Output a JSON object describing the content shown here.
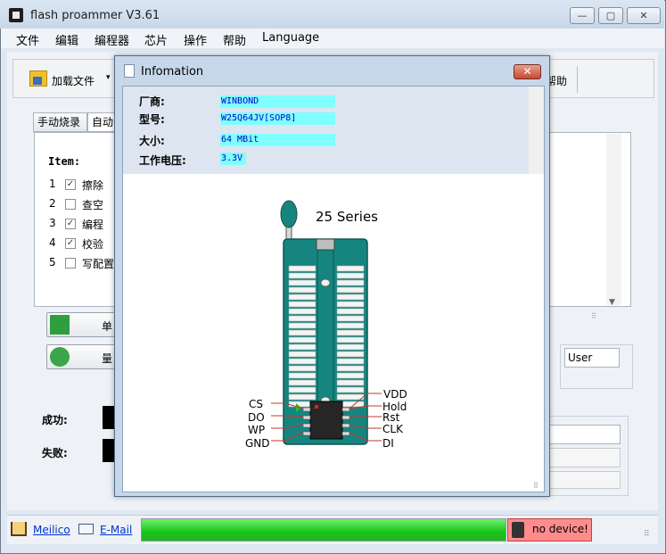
{
  "window": {
    "title": "flash proammer V3.61",
    "min": "—",
    "max": "▢",
    "close": "✕"
  },
  "menu": [
    "文件",
    "编辑",
    "编程器",
    "芯片",
    "操作",
    "帮助",
    "Language"
  ],
  "toolbar": {
    "load_label": "加载文件",
    "load_arrow": "▾",
    "help_label": "帮助"
  },
  "tabs": [
    "手动烧录",
    "自动"
  ],
  "items": {
    "header": "Item:",
    "list": [
      {
        "num": "1",
        "label": "擦除",
        "checked": true
      },
      {
        "num": "2",
        "label": "查空",
        "checked": false
      },
      {
        "num": "3",
        "label": "编程",
        "checked": true
      },
      {
        "num": "4",
        "label": "校验",
        "checked": true
      },
      {
        "num": "5",
        "label": "写配置",
        "checked": false
      }
    ]
  },
  "buttons": {
    "single": "单",
    "batch": "量"
  },
  "stats": {
    "success": "成功:",
    "fail": "失败:"
  },
  "user_field": "User",
  "status": {
    "home_link": "Meilico",
    "mail_link": "E-Mail",
    "device": "no device!",
    "progress": 1.0
  },
  "dialog": {
    "title": "Infomation",
    "close": "✕",
    "fields": [
      {
        "label": "厂商:",
        "value": "WINBOND"
      },
      {
        "label": "型号:",
        "value": "W25Q64JV[SOP8]"
      },
      {
        "label": "大小:",
        "value": "64 MBit"
      },
      {
        "label": "工作电压:",
        "value": "3.3V"
      }
    ],
    "series": "25 Series",
    "pins_left": [
      "CS",
      "DO",
      "WP",
      "GND"
    ],
    "pins_right": [
      "VDD",
      "Hold",
      "Rst",
      "CLK",
      "DI"
    ]
  },
  "colors": {
    "socket": "#16857f",
    "progress": "#18c418",
    "device_bg": "#ff8c8c",
    "info_highlight": "#80ffff"
  }
}
